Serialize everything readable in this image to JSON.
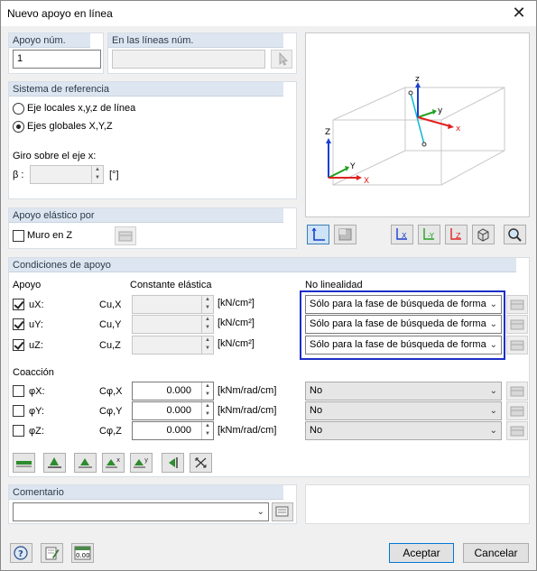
{
  "window": {
    "title": "Nuevo apoyo en línea",
    "close": "✕"
  },
  "apoyo": {
    "num_header": "Apoyo núm.",
    "num_value": "1",
    "lineas_header": "En las líneas núm.",
    "lineas_value": ""
  },
  "sistema": {
    "header": "Sistema de referencia",
    "opt_local": "Eje locales x,y,z  de línea",
    "opt_global": "Ejes globales X,Y,Z",
    "selected": "global",
    "giro_label": "Giro sobre el eje x:",
    "beta_label": "β :",
    "beta_value": "",
    "beta_unit": "[°]"
  },
  "elastico": {
    "header": "Apoyo elástico por",
    "muro_label": "Muro en Z",
    "muro_checked": false
  },
  "preview": {
    "axis_z": "Z",
    "axis_x": "X",
    "axis_y": "Y",
    "local_z": "z",
    "local_y": "y",
    "local_x": "x"
  },
  "condiciones": {
    "header": "Condiciones de apoyo",
    "col_apoyo": "Apoyo",
    "col_const": "Constante elástica",
    "col_nolin": "No linealidad",
    "apoyo_rows": [
      {
        "label": "uX:",
        "sym": "Cu,X",
        "checked": true,
        "value": "",
        "unit": "[kN/cm²]",
        "nolin": "Sólo para la fase de búsqueda de forma"
      },
      {
        "label": "uY:",
        "sym": "Cu,Y",
        "checked": true,
        "value": "",
        "unit": "[kN/cm²]",
        "nolin": "Sólo para la fase de búsqueda de forma"
      },
      {
        "label": "uZ:",
        "sym": "Cu,Z",
        "checked": true,
        "value": "",
        "unit": "[kN/cm²]",
        "nolin": "Sólo para la fase de búsqueda de forma"
      }
    ],
    "coaccion_label": "Coacción",
    "coaccion_rows": [
      {
        "label": "φX:",
        "sym": "Cφ,X",
        "checked": false,
        "value": "0.000",
        "unit": "[kNm/rad/cm]",
        "nolin": "No"
      },
      {
        "label": "φY:",
        "sym": "Cφ,Y",
        "checked": false,
        "value": "0.000",
        "unit": "[kNm/rad/cm]",
        "nolin": "No"
      },
      {
        "label": "φZ:",
        "sym": "Cφ,Z",
        "checked": false,
        "value": "0.000",
        "unit": "[kNm/rad/cm]",
        "nolin": "No"
      }
    ]
  },
  "comentario": {
    "header": "Comentario",
    "value": ""
  },
  "footer": {
    "ok": "Aceptar",
    "cancel": "Cancelar",
    "units_icon_text": "0.00"
  },
  "colors": {
    "highlight": "#1d2ec6",
    "group_header": "#dde6f0",
    "axis_x": "#e02020",
    "axis_y": "#20a020",
    "axis_z": "#1a3fd0",
    "local": "#10b8d0"
  }
}
